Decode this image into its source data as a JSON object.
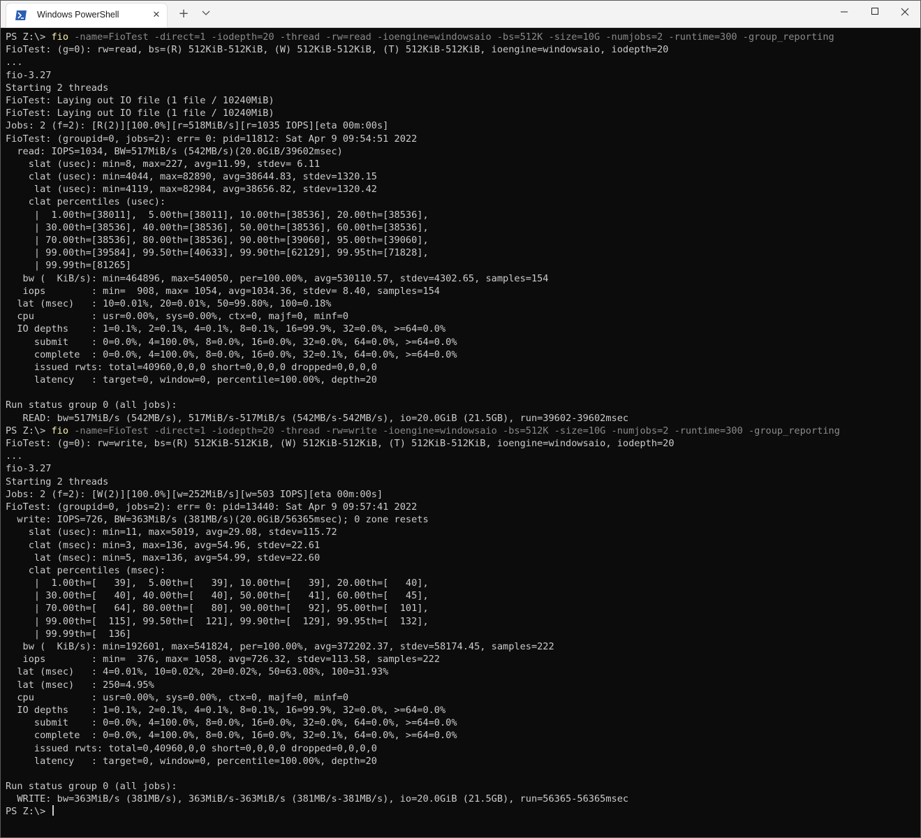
{
  "window": {
    "tab_title": "Windows PowerShell",
    "close_tab_glyph": "✕",
    "new_tab_glyph": "+",
    "dropdown_glyph": "⌄",
    "minimize_glyph": "—",
    "maximize_glyph": "☐",
    "close_glyph": "✕",
    "icon": "powershell-icon"
  },
  "terminal": {
    "prompt": "PS Z:\\> ",
    "command_name": "fio",
    "cmd1_args": " -name=FioTest -direct=1 -iodepth=20 -thread -rw=read -ioengine=windowsaio -bs=512K -size=10G -numjobs=2 -runtime=300 -group_reporting",
    "cmd2_args": " -name=FioTest -direct=1 -iodepth=20 -thread -rw=write -ioengine=windowsaio -bs=512K -size=10G -numjobs=2 -runtime=300 -group_reporting",
    "block1": [
      "FioTest: (g=0): rw=read, bs=(R) 512KiB-512KiB, (W) 512KiB-512KiB, (T) 512KiB-512KiB, ioengine=windowsaio, iodepth=20",
      "...",
      "fio-3.27",
      "Starting 2 threads",
      "FioTest: Laying out IO file (1 file / 10240MiB)",
      "FioTest: Laying out IO file (1 file / 10240MiB)",
      "Jobs: 2 (f=2): [R(2)][100.0%][r=518MiB/s][r=1035 IOPS][eta 00m:00s]",
      "FioTest: (groupid=0, jobs=2): err= 0: pid=11812: Sat Apr 9 09:54:51 2022",
      "  read: IOPS=1034, BW=517MiB/s (542MB/s)(20.0GiB/39602msec)",
      "    slat (usec): min=8, max=227, avg=11.99, stdev= 6.11",
      "    clat (usec): min=4044, max=82890, avg=38644.83, stdev=1320.15",
      "     lat (usec): min=4119, max=82984, avg=38656.82, stdev=1320.42",
      "    clat percentiles (usec):",
      "     |  1.00th=[38011],  5.00th=[38011], 10.00th=[38536], 20.00th=[38536],",
      "     | 30.00th=[38536], 40.00th=[38536], 50.00th=[38536], 60.00th=[38536],",
      "     | 70.00th=[38536], 80.00th=[38536], 90.00th=[39060], 95.00th=[39060],",
      "     | 99.00th=[39584], 99.50th=[40633], 99.90th=[62129], 99.95th=[71828],",
      "     | 99.99th=[81265]",
      "   bw (  KiB/s): min=464896, max=540050, per=100.00%, avg=530110.57, stdev=4302.65, samples=154",
      "   iops        : min=  908, max= 1054, avg=1034.36, stdev= 8.40, samples=154",
      "  lat (msec)   : 10=0.01%, 20=0.01%, 50=99.80%, 100=0.18%",
      "  cpu          : usr=0.00%, sys=0.00%, ctx=0, majf=0, minf=0",
      "  IO depths    : 1=0.1%, 2=0.1%, 4=0.1%, 8=0.1%, 16=99.9%, 32=0.0%, >=64=0.0%",
      "     submit    : 0=0.0%, 4=100.0%, 8=0.0%, 16=0.0%, 32=0.0%, 64=0.0%, >=64=0.0%",
      "     complete  : 0=0.0%, 4=100.0%, 8=0.0%, 16=0.0%, 32=0.1%, 64=0.0%, >=64=0.0%",
      "     issued rwts: total=40960,0,0,0 short=0,0,0,0 dropped=0,0,0,0",
      "     latency   : target=0, window=0, percentile=100.00%, depth=20",
      "",
      "Run status group 0 (all jobs):",
      "   READ: bw=517MiB/s (542MB/s), 517MiB/s-517MiB/s (542MB/s-542MB/s), io=20.0GiB (21.5GB), run=39602-39602msec"
    ],
    "block2": [
      "FioTest: (g=0): rw=write, bs=(R) 512KiB-512KiB, (W) 512KiB-512KiB, (T) 512KiB-512KiB, ioengine=windowsaio, iodepth=20",
      "...",
      "fio-3.27",
      "Starting 2 threads",
      "Jobs: 2 (f=2): [W(2)][100.0%][w=252MiB/s][w=503 IOPS][eta 00m:00s]",
      "FioTest: (groupid=0, jobs=2): err= 0: pid=13440: Sat Apr 9 09:57:41 2022",
      "  write: IOPS=726, BW=363MiB/s (381MB/s)(20.0GiB/56365msec); 0 zone resets",
      "    slat (usec): min=11, max=5019, avg=29.08, stdev=115.72",
      "    clat (msec): min=3, max=136, avg=54.96, stdev=22.61",
      "     lat (msec): min=5, max=136, avg=54.99, stdev=22.60",
      "    clat percentiles (msec):",
      "     |  1.00th=[   39],  5.00th=[   39], 10.00th=[   39], 20.00th=[   40],",
      "     | 30.00th=[   40], 40.00th=[   40], 50.00th=[   41], 60.00th=[   45],",
      "     | 70.00th=[   64], 80.00th=[   80], 90.00th=[   92], 95.00th=[  101],",
      "     | 99.00th=[  115], 99.50th=[  121], 99.90th=[  129], 99.95th=[  132],",
      "     | 99.99th=[  136]",
      "   bw (  KiB/s): min=192601, max=541824, per=100.00%, avg=372202.37, stdev=58174.45, samples=222",
      "   iops        : min=  376, max= 1058, avg=726.32, stdev=113.58, samples=222",
      "  lat (msec)   : 4=0.01%, 10=0.02%, 20=0.02%, 50=63.08%, 100=31.93%",
      "  lat (msec)   : 250=4.95%",
      "  cpu          : usr=0.00%, sys=0.00%, ctx=0, majf=0, minf=0",
      "  IO depths    : 1=0.1%, 2=0.1%, 4=0.1%, 8=0.1%, 16=99.9%, 32=0.0%, >=64=0.0%",
      "     submit    : 0=0.0%, 4=100.0%, 8=0.0%, 16=0.0%, 32=0.0%, 64=0.0%, >=64=0.0%",
      "     complete  : 0=0.0%, 4=100.0%, 8=0.0%, 16=0.0%, 32=0.1%, 64=0.0%, >=64=0.0%",
      "     issued rwts: total=0,40960,0,0 short=0,0,0,0 dropped=0,0,0,0",
      "     latency   : target=0, window=0, percentile=100.00%, depth=20",
      "",
      "Run status group 0 (all jobs):",
      "  WRITE: bw=363MiB/s (381MB/s), 363MiB/s-363MiB/s (381MB/s-381MB/s), io=20.0GiB (21.5GB), run=56365-56365msec"
    ]
  },
  "colors": {
    "terminal_bg": "#0c0c0c",
    "terminal_fg": "#cccccc",
    "command_keyword": "#f9f1a5",
    "command_args": "#8a8a8a",
    "titlebar_bg": "#f3f3f3",
    "powershell_blue": "#2b5fb3"
  }
}
